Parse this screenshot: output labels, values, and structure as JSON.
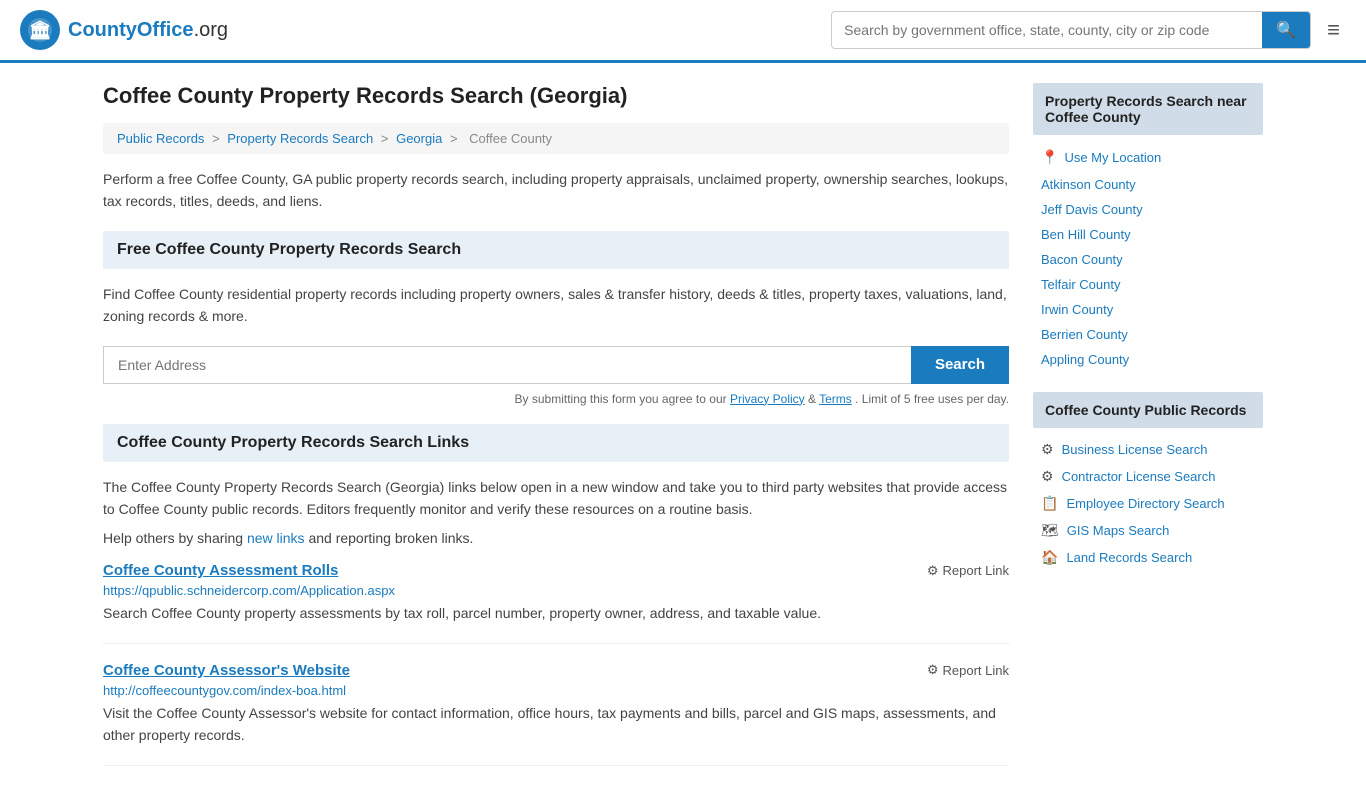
{
  "header": {
    "logo_text": "CountyOffice",
    "logo_suffix": ".org",
    "search_placeholder": "Search by government office, state, county, city or zip code",
    "search_button_label": "🔍"
  },
  "page": {
    "title": "Coffee County Property Records Search (Georgia)"
  },
  "breadcrumb": {
    "items": [
      "Public Records",
      "Property Records Search",
      "Georgia",
      "Coffee County"
    ]
  },
  "description": "Perform a free Coffee County, GA public property records search, including property appraisals, unclaimed property, ownership searches, lookups, tax records, titles, deeds, and liens.",
  "free_search": {
    "header": "Free Coffee County Property Records Search",
    "desc": "Find Coffee County residential property records including property owners, sales & transfer history, deeds & titles, property taxes, valuations, land, zoning records & more.",
    "address_placeholder": "Enter Address",
    "search_button": "Search",
    "form_note": "By submitting this form you agree to our",
    "privacy_label": "Privacy Policy",
    "terms_label": "Terms",
    "limit_note": ". Limit of 5 free uses per day."
  },
  "links_section": {
    "header": "Coffee County Property Records Search Links",
    "desc": "The Coffee County Property Records Search (Georgia) links below open in a new window and take you to third party websites that provide access to Coffee County public records. Editors frequently monitor and verify these resources on a routine basis.",
    "share_text": "Help others by sharing",
    "share_link_label": "new links",
    "share_suffix": " and reporting broken links.",
    "records": [
      {
        "title": "Coffee County Assessment Rolls",
        "url": "https://qpublic.schneidercorp.com/Application.aspx",
        "desc": "Search Coffee County property assessments by tax roll, parcel number, property owner, address, and taxable value.",
        "report": "Report Link"
      },
      {
        "title": "Coffee County Assessor's Website",
        "url": "http://coffeecountygov.com/index-boa.html",
        "desc": "Visit the Coffee County Assessor's website for contact information, office hours, tax payments and bills, parcel and GIS maps, assessments, and other property records.",
        "report": "Report Link"
      }
    ]
  },
  "sidebar": {
    "nearby_header": "Property Records Search near Coffee County",
    "use_my_location": "Use My Location",
    "nearby_counties": [
      "Atkinson County",
      "Jeff Davis County",
      "Ben Hill County",
      "Bacon County",
      "Telfair County",
      "Irwin County",
      "Berrien County",
      "Appling County"
    ],
    "public_records_header": "Coffee County Public Records",
    "public_records_links": [
      {
        "icon": "⚙",
        "label": "Business License Search"
      },
      {
        "icon": "⚙",
        "label": "Contractor License Search"
      },
      {
        "icon": "📋",
        "label": "Employee Directory Search"
      },
      {
        "icon": "🗺",
        "label": "GIS Maps Search"
      },
      {
        "icon": "🏠",
        "label": "Land Records Search"
      }
    ]
  }
}
